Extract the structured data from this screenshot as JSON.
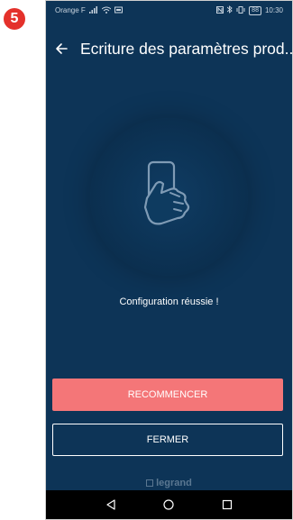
{
  "step_badge": "5",
  "status_bar": {
    "carrier": "Orange F",
    "time": "10:30",
    "battery": "88"
  },
  "app_bar": {
    "title": "Ecriture des paramètres prod..."
  },
  "main": {
    "message": "Configuration réussie !"
  },
  "buttons": {
    "restart_label": "RECOMMENCER",
    "close_label": "FERMER"
  },
  "brand": {
    "name": "legrand"
  },
  "colors": {
    "background": "#0d3457",
    "accent": "#f47678",
    "badge": "#e4312b"
  }
}
